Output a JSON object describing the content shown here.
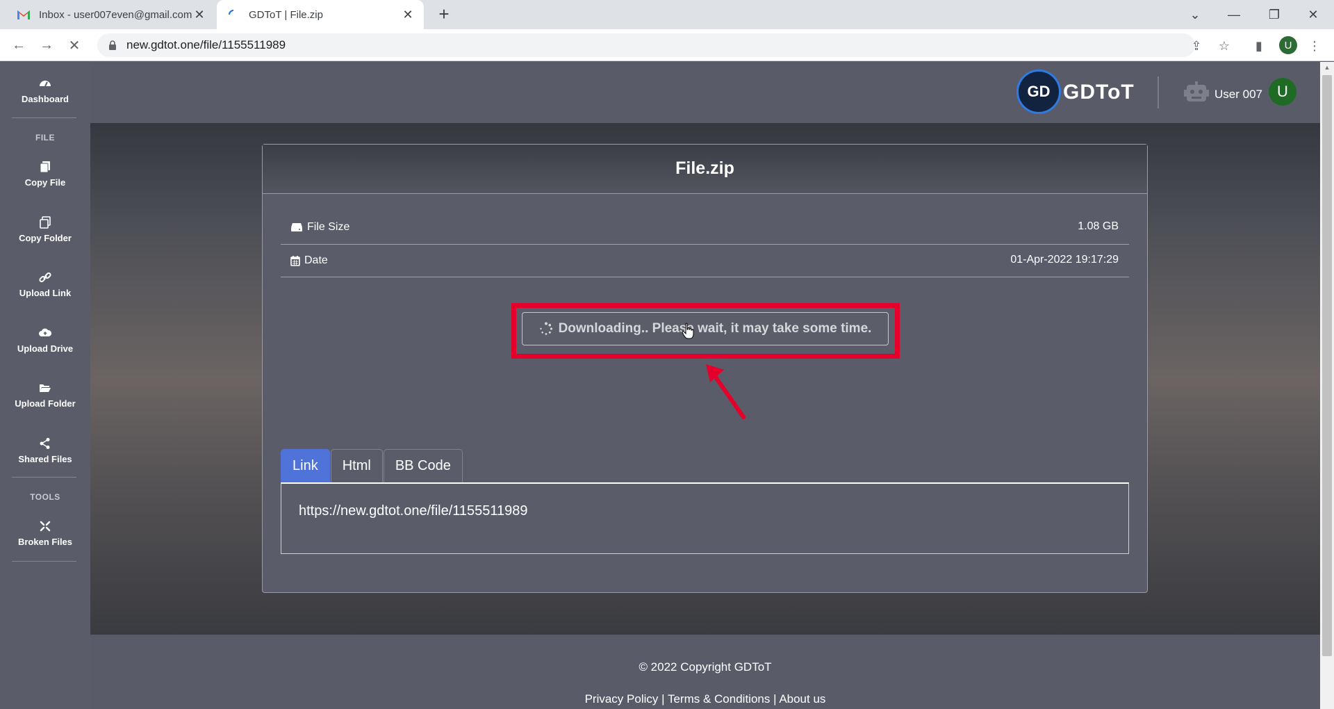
{
  "browser": {
    "tabs": [
      {
        "title": "Inbox - user007even@gmail.com",
        "favicon": "gmail-icon",
        "active": false
      },
      {
        "title": "GDToT | File.zip",
        "favicon": "loading-spinner-icon",
        "active": true
      }
    ],
    "url": "new.gdtot.one/file/1155511989",
    "profile_initial": "U"
  },
  "sidebar": {
    "dashboard": "Dashboard",
    "section_file": "FILE",
    "copy_file": "Copy File",
    "copy_folder": "Copy Folder",
    "upload_link": "Upload Link",
    "upload_drive": "Upload Drive",
    "upload_folder": "Upload Folder",
    "shared_files": "Shared Files",
    "section_tools": "TOOLS",
    "broken_files": "Broken Files"
  },
  "header": {
    "logo_badge": "GD",
    "logo_text": "GDToT",
    "user_name": "User 007",
    "user_initial": "U"
  },
  "file": {
    "title": "File.zip",
    "size_label": "File Size",
    "size_value": "1.08 GB",
    "date_label": "Date",
    "date_value": "01-Apr-2022 19:17:29",
    "download_status": "Downloading.. Please wait, it may take some time."
  },
  "share": {
    "tabs": [
      "Link",
      "Html",
      "BB Code"
    ],
    "active_tab": "Link",
    "link_value": "https://new.gdtot.one/file/1155511989"
  },
  "footer": {
    "copyright": "© 2022 Copyright GDToT",
    "privacy": "Privacy Policy",
    "terms": "Terms & Conditions",
    "about": "About us",
    "separator": "|"
  },
  "colors": {
    "highlight_red": "#e5002b",
    "active_tab_blue": "#4f73d9",
    "avatar_green": "#1f6b25"
  }
}
